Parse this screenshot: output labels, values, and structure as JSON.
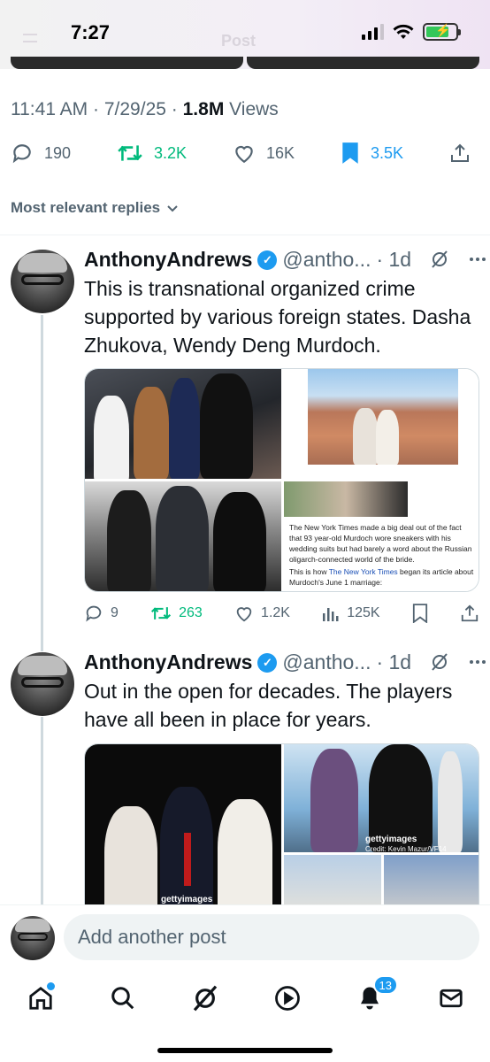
{
  "status_bar": {
    "time": "7:27",
    "faded_title": "Post"
  },
  "tweet_meta": {
    "time": "11:41 AM",
    "date": "7/29/25",
    "views": "1.8M",
    "views_label": "Views",
    "sep": "·"
  },
  "stats": {
    "replies": "190",
    "reposts": "3.2K",
    "likes": "16K",
    "bookmarks": "3.5K"
  },
  "replies_filter": {
    "label": "Most relevant replies"
  },
  "posts": [
    {
      "name": "AnthonyAndrews",
      "handle": "@antho...",
      "time": "· 1d",
      "text": "This is transnational organized crime supported by various foreign states. Dasha Zhukova, Wendy Deng Murdoch.",
      "article_line1": "The New York Times made a big deal out of the fact that 93 year-old Murdoch wore sneakers with his wedding suits but had barely a word about the Russian oligarch-connected world of the bride.",
      "article_line2a": "This is how ",
      "article_link": "The New York Times",
      "article_line2b": " began its article about Murdoch's June 1 marriage:",
      "replies": "9",
      "reposts": "263",
      "likes": "1.2K",
      "views": "125K"
    },
    {
      "name": "AnthonyAndrews",
      "handle": "@antho...",
      "time": "· 1d",
      "text": "Out in the open for decades. The players have all been in place for years.",
      "getty1": "gettyimages",
      "getty2": "gettyimages",
      "getty2_credit": "Credit: Kevin Mazur/VF14"
    }
  ],
  "compose": {
    "placeholder": "Add another post"
  },
  "nav": {
    "notifications_count": "13"
  },
  "colors": {
    "accent": "#1d9bf0",
    "repost_green": "#00ba7c",
    "muted": "#536471"
  }
}
